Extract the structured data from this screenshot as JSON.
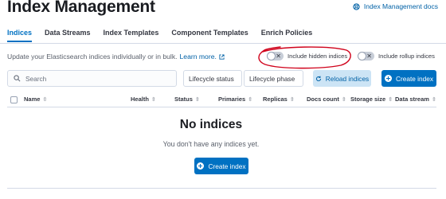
{
  "header": {
    "title": "Index Management",
    "docs_link": "Index Management docs"
  },
  "tabs": [
    {
      "label": "Indices",
      "active": true
    },
    {
      "label": "Data Streams",
      "active": false
    },
    {
      "label": "Index Templates",
      "active": false
    },
    {
      "label": "Component Templates",
      "active": false
    },
    {
      "label": "Enrich Policies",
      "active": false
    }
  ],
  "description": {
    "text": "Update your Elasticsearch indices individually or in bulk.",
    "link": "Learn more."
  },
  "toggles": {
    "hidden": {
      "label": "Include hidden indices",
      "checked": false
    },
    "rollup": {
      "label": "Include rollup indices",
      "checked": false
    }
  },
  "toolbar": {
    "search_placeholder": "Search",
    "lifecycle_status": "Lifecycle status",
    "lifecycle_phase": "Lifecycle phase",
    "reload_label": "Reload indices",
    "create_label": "Create index"
  },
  "table": {
    "columns": [
      "Name",
      "Health",
      "Status",
      "Primaries",
      "Replicas",
      "Docs count",
      "Storage size",
      "Data stream"
    ]
  },
  "empty_state": {
    "title": "No indices",
    "body": "You don't have any indices yet.",
    "button": "Create index"
  },
  "colors": {
    "accent": "#0071c2",
    "annotation": "#d0021b"
  }
}
